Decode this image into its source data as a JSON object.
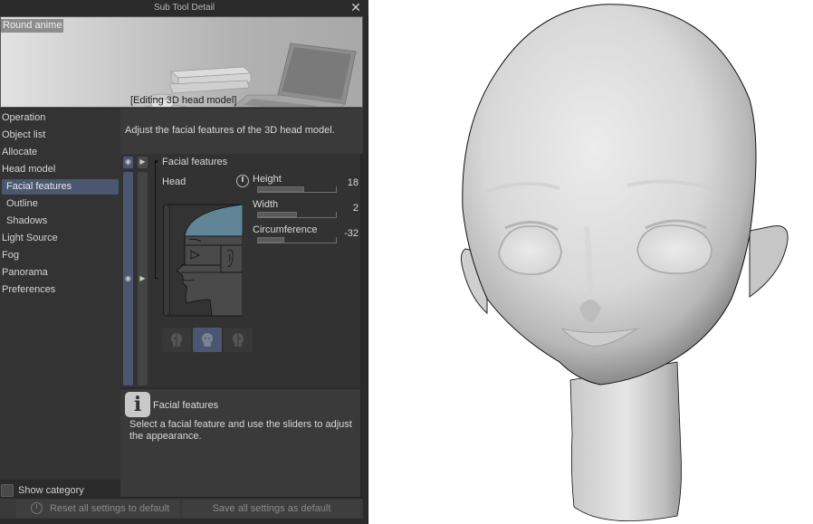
{
  "window": {
    "title": "Sub Tool Detail",
    "close_icon": "close-icon"
  },
  "banner": {
    "preset_name": "Round anime",
    "caption": "[Editing 3D head model]"
  },
  "nav": {
    "items": [
      {
        "label": "Operation",
        "level": 0,
        "selected": false
      },
      {
        "label": "Object list",
        "level": 0,
        "selected": false
      },
      {
        "label": "Allocate",
        "level": 0,
        "selected": false
      },
      {
        "label": "Head model",
        "level": 0,
        "selected": false
      },
      {
        "label": "Facial features",
        "level": 1,
        "selected": true
      },
      {
        "label": "Outline",
        "level": 1,
        "selected": false
      },
      {
        "label": "Shadows",
        "level": 1,
        "selected": false
      },
      {
        "label": "Light Source",
        "level": 0,
        "selected": false
      },
      {
        "label": "Fog",
        "level": 0,
        "selected": false
      },
      {
        "label": "Panorama",
        "level": 0,
        "selected": false
      },
      {
        "label": "Preferences",
        "level": 0,
        "selected": false
      }
    ],
    "show_category_label": "Show category",
    "show_category_checked": false
  },
  "description": "Adjust the facial features of the 3D head model.",
  "settings": {
    "section_title": "Facial features",
    "part_label": "Head",
    "params": [
      {
        "label": "Height",
        "value": "18",
        "fill_fraction": 0.6
      },
      {
        "label": "Width",
        "value": "2",
        "fill_fraction": 0.51
      },
      {
        "label": "Circumference",
        "value": "-32",
        "fill_fraction": 0.34
      }
    ],
    "view_buttons": [
      {
        "name": "left-half-face",
        "active": false
      },
      {
        "name": "full-face",
        "active": true
      },
      {
        "name": "right-half-face",
        "active": false
      }
    ],
    "highlight_color": "#5f8596"
  },
  "info": {
    "title": "Facial features",
    "text": "Select a facial feature and use the sliders to adjust the appearance."
  },
  "footer": {
    "reset_label": "Reset all settings to default",
    "save_label": "Save all settings as default"
  },
  "colors": {
    "accent": "#4b5670",
    "panel_bg": "#2b2b2b"
  }
}
